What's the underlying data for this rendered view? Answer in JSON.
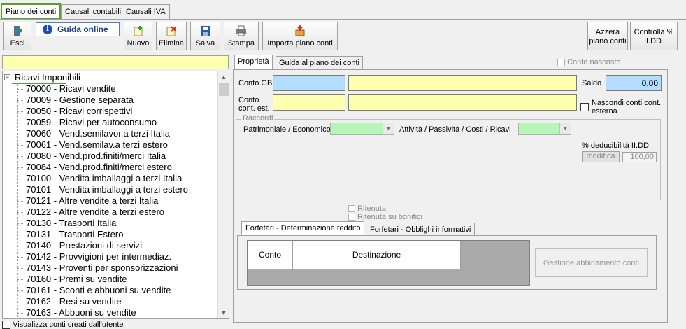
{
  "tabs": [
    "Piano dei conti",
    "Causali contabili",
    "Causali IVA"
  ],
  "toolbar": {
    "esci": "Esci",
    "guida": "Guida online",
    "nuovo": "Nuovo",
    "elimina": "Elimina",
    "salva": "Salva",
    "stampa": "Stampa",
    "importa": "Importa piano conti",
    "azzera_line1": "Azzera",
    "azzera_line2": "piano conti",
    "controlla_line1": "Controlla %",
    "controlla_line2": "II.DD."
  },
  "search": {
    "value": ""
  },
  "tree": {
    "root": "Ricavi Imponibili",
    "items": [
      "70000 - Ricavi vendite",
      "70009 - Gestione separata",
      "70050 - Ricavi corrispettivi",
      "70059 - Ricavi per autoconsumo",
      "70060 - Vend.semilavor.a terzi Italia",
      "70061 - Vend.semilav.a terzi estero",
      "70080 - Vend.prod.finiti/merci Italia",
      "70084 - Vend.prod.finiti/merci estero",
      "70100 - Vendita imballaggi a terzi Italia",
      "70101 - Vendita imballaggi a terzi estero",
      "70121 - Altre vendite a terzi Italia",
      "70122 - Altre vendite a terzi estero",
      "70130 - Trasporti Italia",
      "70131 - Trasporti Estero",
      "70140 - Prestazioni di servizi",
      "70142 - Provvigioni per intermediaz.",
      "70143 - Proventi per sponsorizzazioni",
      "70160 - Premi su vendite",
      "70161 - Sconti e abbuoni su vendite",
      "70162 - Resi su vendite",
      "70163 - Abbuoni su vendite"
    ]
  },
  "visualizza": "Visualizza conti creati dall'utente",
  "right_tabs": [
    "Proprietà",
    "Guida al piano dei conti"
  ],
  "conto_nascosto": "Conto nascosto",
  "form": {
    "conto_gb": "Conto GB",
    "conto_est_1": "Conto",
    "conto_est_2": "cont. est.",
    "saldo": "Saldo",
    "saldo_value": "0,00",
    "nascondi_1": "Nascondi conti cont.",
    "nascondi_2": "esterna"
  },
  "raccordi": {
    "title": "Raccordi",
    "patrimoniale": "Patrimoniale / Economico",
    "attivita": "Attività / Passività / Costi / Ricavi",
    "deducibilita": "% deducibilità II.DD.",
    "modifica": "modifica",
    "ded_value": "100,00"
  },
  "ritenuta": "Ritenuta",
  "ritenuta_bonifici": "Ritenuta su bonifici",
  "forfetari_tabs": [
    "Forfetari - Determinazione reddito",
    "Forfetari - Obblighi informativi"
  ],
  "grid": {
    "col1": "Conto",
    "col2": "Destinazione"
  },
  "gestione": "Gestione abbinamento conti",
  "colors": {
    "accent_green": "#5a9e2f",
    "field_blue": "#b3dcff",
    "field_yellow": "#ffffb0",
    "field_green": "#b8f5b8"
  }
}
